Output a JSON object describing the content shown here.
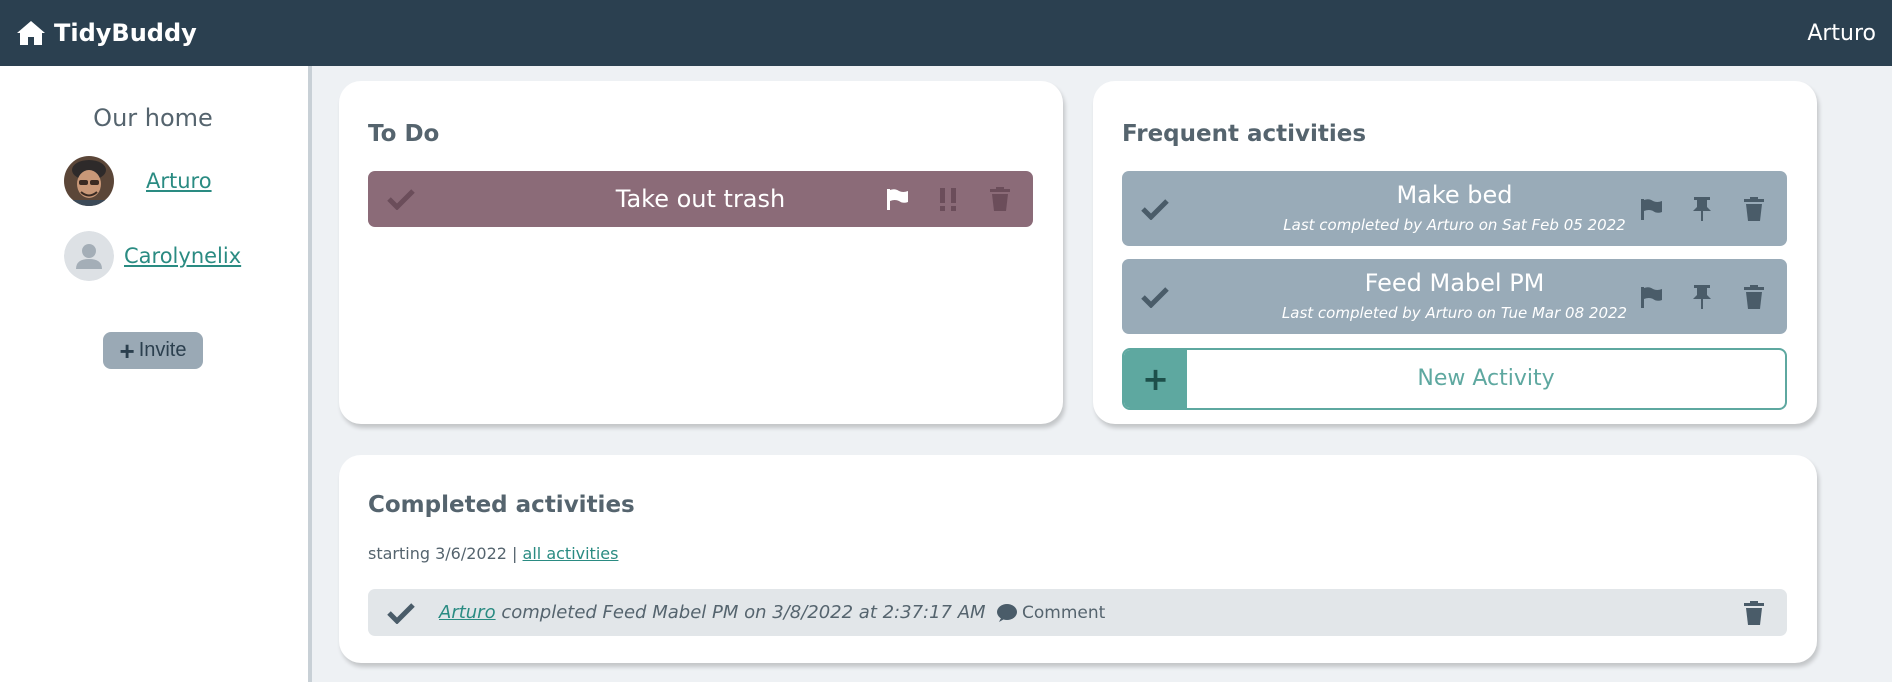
{
  "app": {
    "name": "TidyBuddy",
    "user": "Arturo"
  },
  "sidebar": {
    "title": "Our home",
    "members": [
      {
        "name": "Arturo",
        "avatar": "photo"
      },
      {
        "name": "Carolynelix",
        "avatar": "placeholder"
      }
    ],
    "invite_label": "Invite"
  },
  "todo": {
    "title": "To Do",
    "items": [
      {
        "label": "Take out trash",
        "color": "#8b6b78",
        "icons": [
          "check-icon",
          "flag-icon",
          "priority-icon",
          "trash-icon"
        ]
      }
    ]
  },
  "frequent": {
    "title": "Frequent activities",
    "items": [
      {
        "name": "Make bed",
        "subtitle": "Last completed by Arturo on Sat Feb 05 2022"
      },
      {
        "name": "Feed Mabel PM",
        "subtitle": "Last completed by Arturo on Tue Mar 08 2022"
      }
    ],
    "new_label": "New Activity"
  },
  "completed": {
    "title": "Completed activities",
    "starting": "starting 3/6/2022 |",
    "all_link": "all activities",
    "entries": [
      {
        "user": "Arturo",
        "text": "completed Feed Mabel PM on 3/8/2022 at 2:37:17 AM",
        "comment_label": "Comment"
      }
    ]
  },
  "colors": {
    "topbar": "#2b4050",
    "accent": "#2a8b82",
    "todo_item": "#8b6b78",
    "frequent_item": "#99abb8",
    "new_button": "#5ea8a0"
  }
}
